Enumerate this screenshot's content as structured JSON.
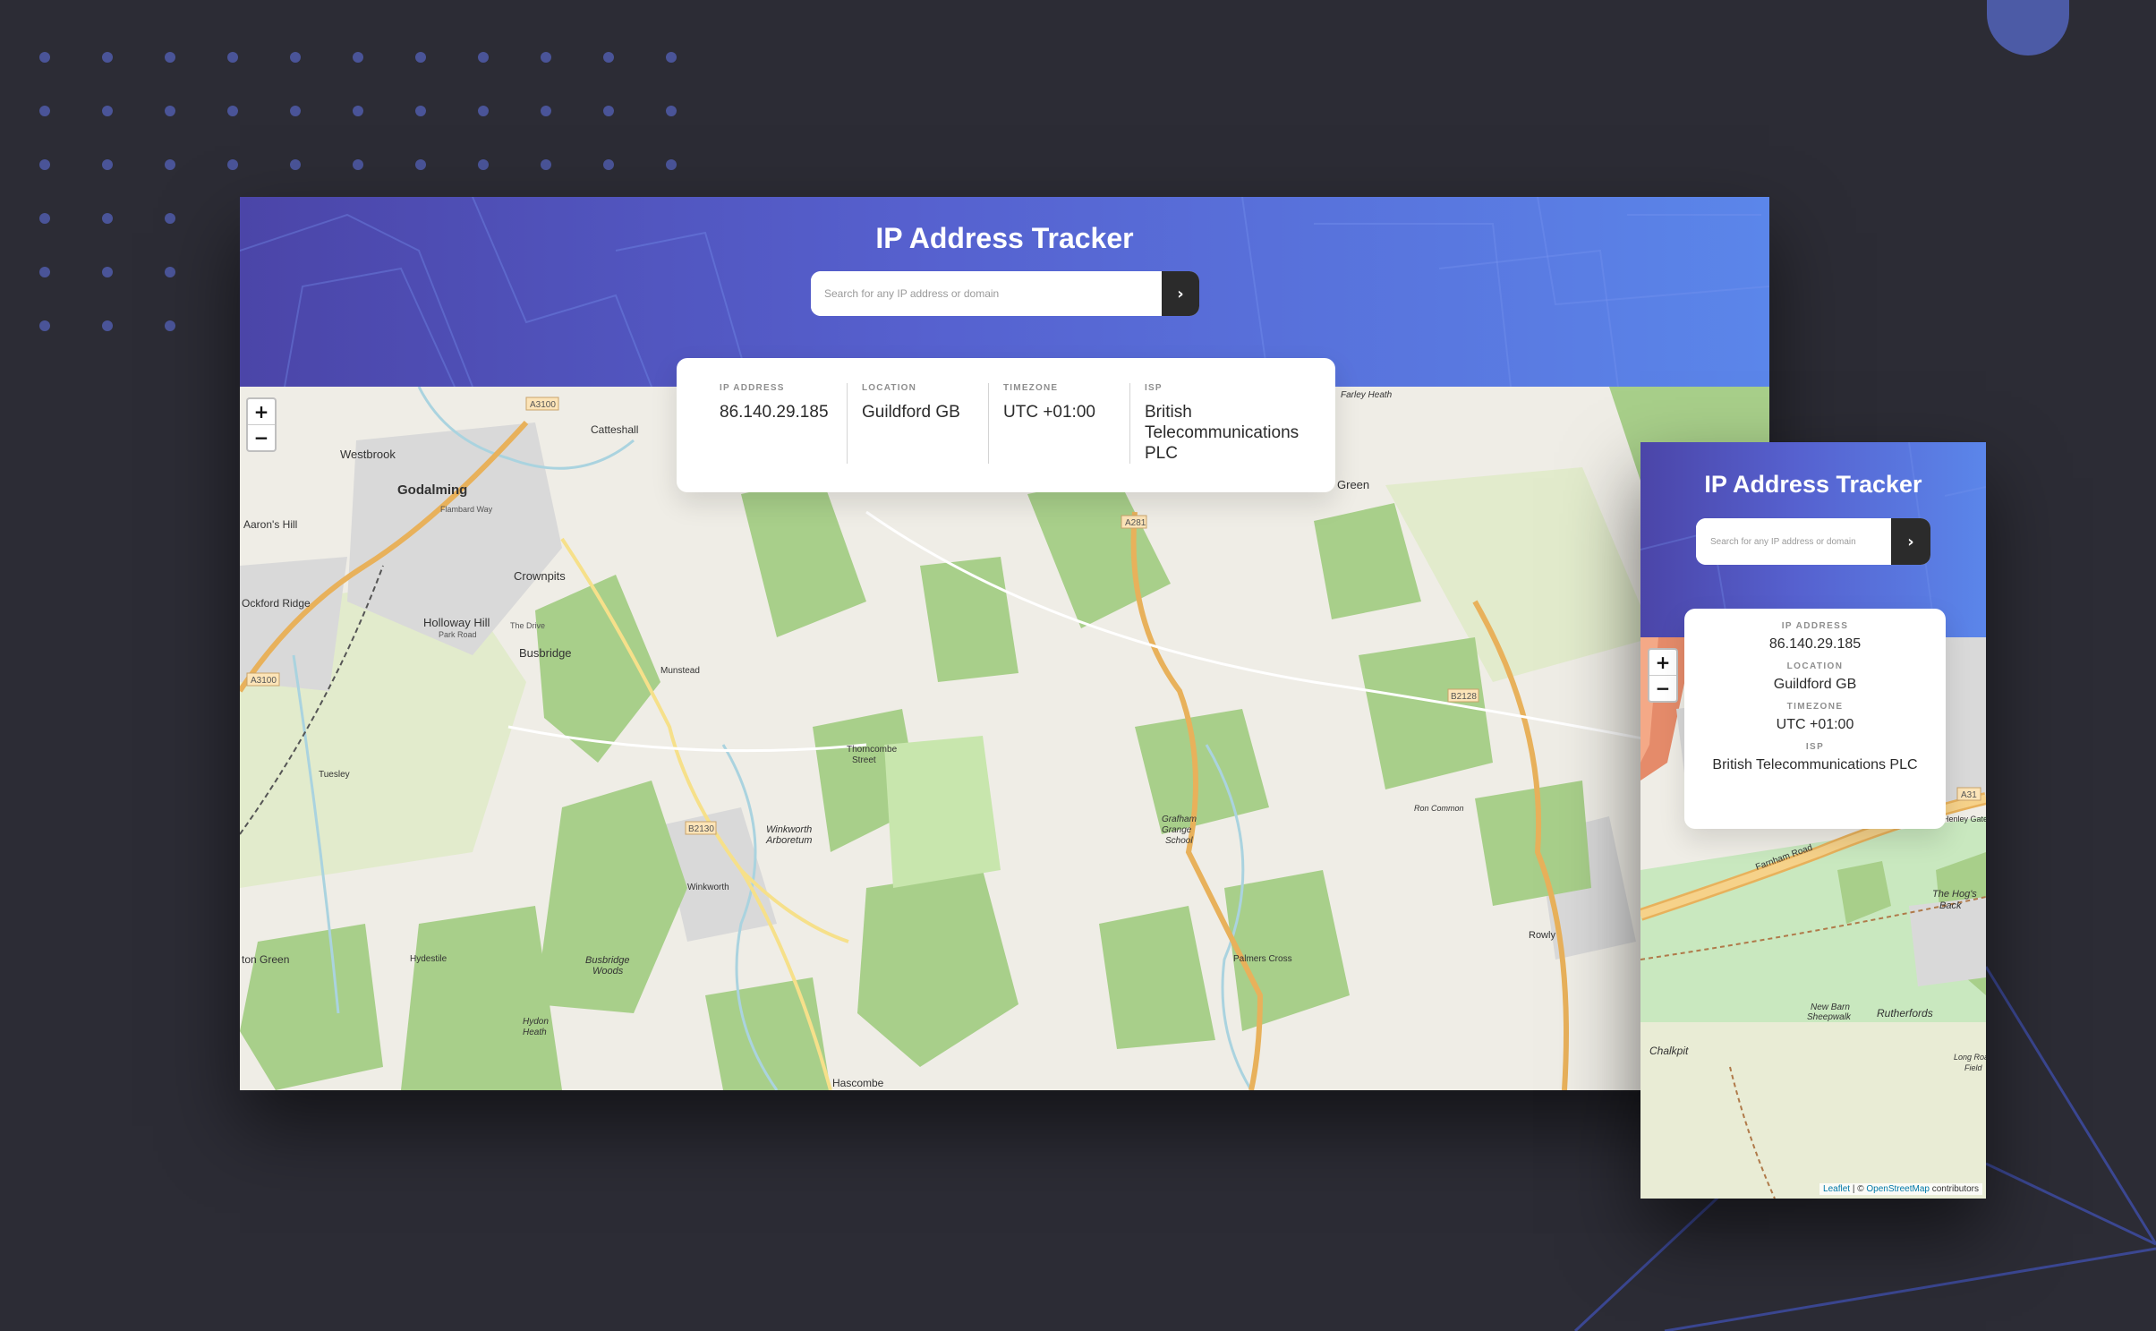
{
  "app": {
    "title": "IP Address Tracker",
    "search_placeholder": "Search for any IP address or domain",
    "submit_icon": "chevron-right-icon"
  },
  "result": {
    "ip_label": "IP ADDRESS",
    "ip_value": "86.140.29.185",
    "location_label": "LOCATION",
    "location_value": "Guildford GB",
    "timezone_label": "TIMEZONE",
    "timezone_value": "UTC +01:00",
    "isp_label": "ISP",
    "isp_value": "British Telecommunications PLC"
  },
  "map": {
    "zoom_in": "+",
    "zoom_out": "−",
    "attribution_leaflet": "Leaflet",
    "attribution_sep": " | © ",
    "attribution_osm": "OpenStreetMap",
    "attribution_suffix": " contributors",
    "desktop_places": [
      "Godalming",
      "Westbrook",
      "Catteshall",
      "Aaron's Hill",
      "Crownpits",
      "Ockford Ridge",
      "Holloway Hill",
      "Busbridge",
      "Tuesley",
      "Munstead",
      "Thorncombe Street",
      "Winkworth Arboretum",
      "Winkworth",
      "Busbridge Woods",
      "Hydestile",
      "Hydon Heath",
      "Hascombe",
      "Grafham Grange School",
      "Palmers Cross",
      "Rowly",
      "Farley Heath",
      "Green",
      "Ron Common"
    ],
    "desktop_roads": [
      "A3100",
      "A281",
      "B2130",
      "B2128",
      "Flambard Way",
      "Park Road",
      "The Drive"
    ],
    "mobile_places": [
      "Farnham Road",
      "The Hog's Back",
      "New Barn Sheepwalk",
      "Rutherfords",
      "Chalkpit",
      "Henley Gate",
      "Long Roads Field"
    ],
    "mobile_roads": [
      "A31"
    ]
  },
  "colors": {
    "background": "#2c2c35",
    "hero_start": "#4b45a8",
    "hero_end": "#5b86ea",
    "button": "#2b2b2b",
    "woodland": "#a8cf8a",
    "road_major": "#e8b15b",
    "water": "#aad3df"
  }
}
